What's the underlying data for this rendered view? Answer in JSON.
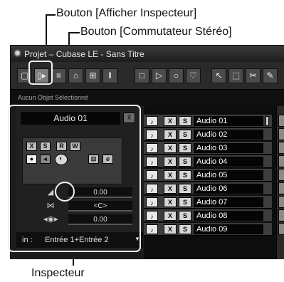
{
  "callouts": {
    "inspector_button": "Bouton [Afficher Inspecteur]",
    "stereo_button": "Bouton [Commutateur Stéréo]",
    "inspector": "Inspecteur"
  },
  "window": {
    "title": "Projet – Cubase LE - Sans Titre",
    "strip_text": "Aucun Objet Sélectionné"
  },
  "inspector": {
    "track_name": "Audio 01",
    "mute_label": "X",
    "solo_label": "S",
    "read_label": "R",
    "write_label": "W",
    "volume": "0.00",
    "pan": "<C>",
    "delay": "0.00",
    "input_label": "in :",
    "input_value": "Entrée 1+Entrée 2"
  },
  "tracks": [
    {
      "mute": "X",
      "solo": "S",
      "name": "Audio 01"
    },
    {
      "mute": "X",
      "solo": "S",
      "name": "Audio 02"
    },
    {
      "mute": "X",
      "solo": "S",
      "name": "Audio 03"
    },
    {
      "mute": "X",
      "solo": "S",
      "name": "Audio 04"
    },
    {
      "mute": "X",
      "solo": "S",
      "name": "Audio 05"
    },
    {
      "mute": "X",
      "solo": "S",
      "name": "Audio 06"
    },
    {
      "mute": "X",
      "solo": "S",
      "name": "Audio 07"
    },
    {
      "mute": "X",
      "solo": "S",
      "name": "Audio 08"
    },
    {
      "mute": "X",
      "solo": "S",
      "name": "Audio 09"
    }
  ],
  "icons": {
    "inspector_toggle": "show-inspector-icon",
    "stereo_toggle": "stereo-switch-icon",
    "pointer": "pointer-tool-icon"
  },
  "colors": {
    "background": "#1b1b1b",
    "track_name_bg": "#050505",
    "highlight": "#f2f2f2"
  }
}
